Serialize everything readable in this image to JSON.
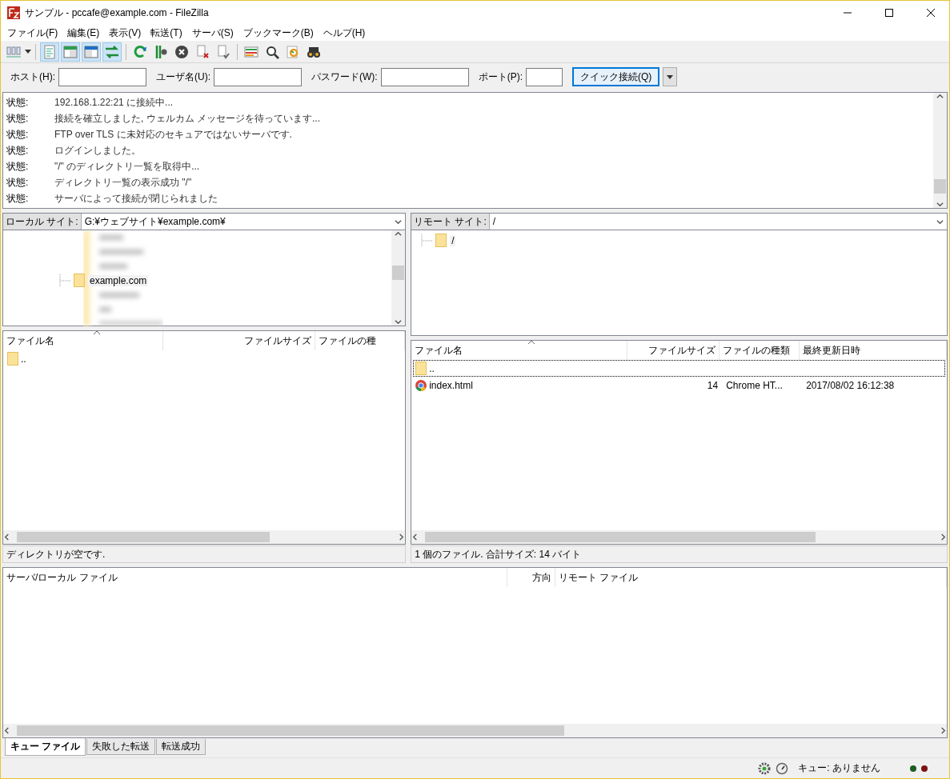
{
  "window": {
    "title": "サンプル - pccafe@example.com - FileZilla"
  },
  "menu": [
    "ファイル(F)",
    "編集(E)",
    "表示(V)",
    "転送(T)",
    "サーバ(S)",
    "ブックマーク(B)",
    "ヘルプ(H)"
  ],
  "toolbar": {
    "toggles": [
      {
        "pressed": true
      },
      {
        "pressed": true
      },
      {
        "pressed": true
      },
      {
        "pressed": true
      }
    ]
  },
  "quickconnect": {
    "fields": [
      {
        "label": "ホスト(H):"
      },
      {
        "label": "ユーザ名(U):"
      },
      {
        "label": "パスワード(W):"
      },
      {
        "label": "ポート(P):"
      }
    ],
    "button": "クイック接続(Q)"
  },
  "log": [
    {
      "label": "状態:",
      "message": "192.168.1.22:21 に接続中..."
    },
    {
      "label": "状態:",
      "message": "接続を確立しました, ウェルカム メッセージを待っています..."
    },
    {
      "label": "状態:",
      "message": "FTP over TLS に未対応のセキュアではないサーバです."
    },
    {
      "label": "状態:",
      "message": "ログインしました。"
    },
    {
      "label": "状態:",
      "message": "\"/\" のディレクトリ一覧を取得中..."
    },
    {
      "label": "状態:",
      "message": "ディレクトリ一覧の表示成功 \"/\""
    },
    {
      "label": "状態:",
      "message": "サーバによって接続が閉じられました"
    }
  ],
  "local": {
    "site_label": "ローカル サイト:",
    "path": "G:¥ウェブサイト¥example.com¥",
    "tree_item": "example.com",
    "columns": [
      "ファイル名",
      "ファイルサイズ",
      "ファイルの種"
    ],
    "rows": [
      {
        "name": "..",
        "kind": "folder",
        "selected": false
      }
    ],
    "status": "ディレクトリが空です."
  },
  "remote": {
    "site_label": "リモート サイト:",
    "path": "/",
    "tree_item": "/",
    "columns": [
      "ファイル名",
      "ファイルサイズ",
      "ファイルの種類",
      "最終更新日時"
    ],
    "rows": [
      {
        "name": "..",
        "kind": "folder",
        "selected": true
      },
      {
        "name": "index.html",
        "kind": "html",
        "size": "14",
        "type": "Chrome HT...",
        "modified": "2017/08/02 16:12:38",
        "selected": false
      }
    ],
    "status": "1 個のファイル. 合計サイズ: 14 バイト"
  },
  "queue": {
    "columns": [
      "サーバ/ローカル ファイル",
      "方向",
      "リモート ファイル"
    ]
  },
  "queue_tabs": [
    {
      "label": "キュー ファイル",
      "selected": true
    },
    {
      "label": "失敗した転送",
      "selected": false
    },
    {
      "label": "転送成功",
      "selected": false
    }
  ],
  "status_bar": {
    "queue": "キュー: ありません"
  }
}
